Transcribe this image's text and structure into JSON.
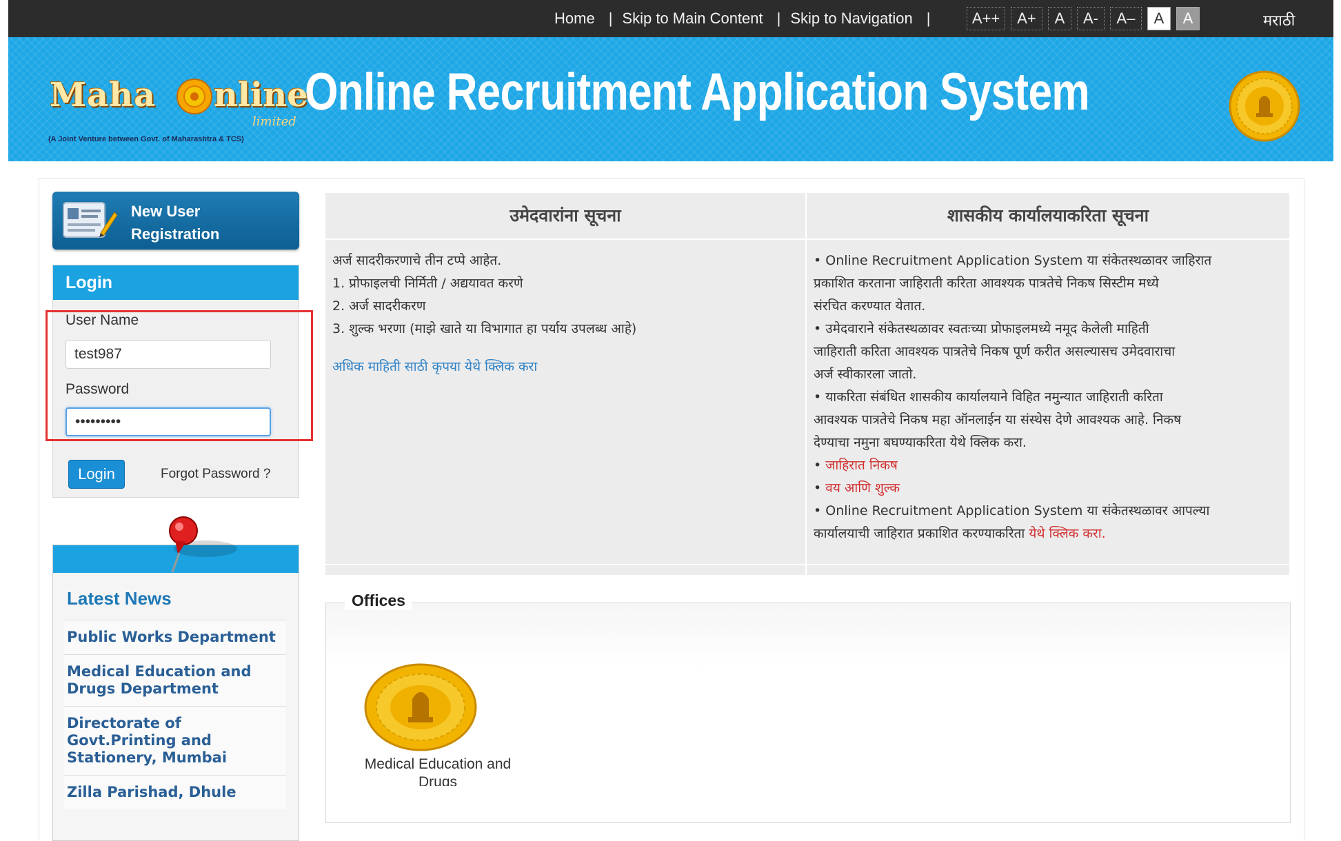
{
  "topnav": {
    "home": "Home",
    "skip_main": "Skip to Main Content",
    "skip_nav": "Skip to Navigation",
    "sep": "|",
    "font_sizes": [
      "A++",
      "A+",
      "A",
      "A-",
      "A–"
    ],
    "contrast_light": "A",
    "contrast_dark": "A",
    "language": "मराठी"
  },
  "banner": {
    "logo_word_1": "Maha",
    "logo_word_2": "nline",
    "logo_limited": "limited",
    "logo_tagline": "(A Joint Venture between Govt. of Maharashtra & TCS)",
    "title": "Online Recruitment Application System"
  },
  "sidebar": {
    "new_user_label": "New User Registration",
    "login": {
      "heading": "Login",
      "username_label": "User Name",
      "username_value": "test987",
      "password_label": "Password",
      "password_value": "•••••••••",
      "login_button": "Login",
      "forgot_link": "Forgot Password ?"
    },
    "news": {
      "heading": "Latest News",
      "items": [
        "Public Works Department",
        "Medical Education and Drugs Department",
        "Directorate of Govt.Printing and Stationery, Mumbai",
        "Zilla Parishad, Dhule"
      ]
    }
  },
  "notices": {
    "candidates": {
      "heading": "उमेदवारांना सूचना",
      "lines": [
        "अर्ज सादरीकरणाचे तीन टप्पे आहेत.",
        "1. प्रोफाइलची निर्मिती / अद्ययावत करणे",
        "2. अर्ज सादरीकरण",
        "3. शुल्क भरणा (माझे खाते या विभागात हा पर्याय उपलब्ध आहे)"
      ],
      "more_link": "अधिक माहिती साठी कृपया येथे क्लिक करा"
    },
    "offices_notice": {
      "heading": "शासकीय कार्यालयाकरिता सूचना",
      "p1": [
        "• Online Recruitment Application System या संकेतस्थळावर जाहिरात",
        "प्रकाशित करताना जाहिराती करिता आवश्यक पात्रतेचे निकष सिस्टीम मध्ये",
        "संरचित करण्यात येतात."
      ],
      "p2": [
        "• उमेदवाराने संकेतस्थळावर स्वतःच्या प्रोफाइलमध्ये नमूद केलेली माहिती",
        "जाहिराती करिता आवश्यक पात्रतेचे निकष पूर्ण करीत असल्यासच उमेदवाराचा",
        "अर्ज स्वीकारला जातो."
      ],
      "p3": [
        "• याकरिता संबंधित शासकीय कार्यालयाने विहित नमुन्यात जाहिराती करिता",
        "आवश्यक पात्रतेचे निकष महा ऑनलाईन या संस्थेस देणे आवश्यक आहे. निकष",
        "देण्याचा नमुना बघण्याकरिता येथे क्लिक करा."
      ],
      "bullet": "•",
      "link_criteria": "जाहिरात निकष",
      "link_age_fee": "वय आणि शुल्क",
      "p4_line1": "• Online Recruitment Application System या संकेतस्थळावर आपल्या",
      "p4_line2_text": "कार्यालयाची जाहिरात प्रकाशित करण्याकरिता ",
      "p4_link": "येथे क्लिक करा."
    }
  },
  "offices": {
    "legend": "Offices",
    "items": [
      {
        "name": "Medical Education and Drugs"
      }
    ]
  },
  "colors": {
    "topbar": "#2c2c2c",
    "banner": "#1ea7e6",
    "accent_blue": "#1ba2e1",
    "highlight_red": "#e53030"
  }
}
